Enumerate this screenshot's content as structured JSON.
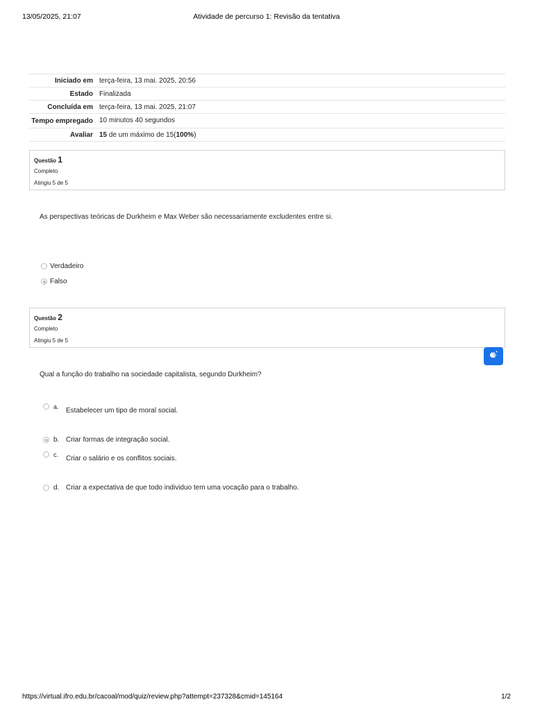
{
  "print": {
    "datetime": "13/05/2025, 21:07",
    "title": "Atividade de percurso 1: Revisão da tentativa",
    "url": "https://virtual.ifro.edu.br/cacoal/mod/quiz/review.php?attempt=237328&cmid=145164",
    "page": "1/2"
  },
  "summary": [
    {
      "label": "Iniciado em",
      "value": "terça-feira, 13 mai. 2025, 20:56"
    },
    {
      "label": "Estado",
      "value": "Finalizada"
    },
    {
      "label": "Concluída em",
      "value": "terça-feira, 13 mai. 2025, 21:07"
    },
    {
      "label": "Tempo empregado",
      "value": "10 minutos 40 segundos"
    },
    {
      "label": "Avaliar",
      "value_bold": "15",
      "value_mid": " de um máximo de 15(",
      "value_bold2": "100%",
      "value_end": ")"
    }
  ],
  "q1": {
    "prefix": "Questão",
    "number": "1",
    "state": "Completo",
    "grade": "Atingiu 5 de 5",
    "text": "As perspectivas teóricas de Durkheim e Max Weber são necessariamente excludentes entre si.",
    "options": [
      {
        "label": "Verdadeiro",
        "selected": false
      },
      {
        "label": "Falso",
        "selected": true
      }
    ]
  },
  "q2": {
    "prefix": "Questão",
    "number": "2",
    "state": "Completo",
    "grade": "Atingiu 5 de 5",
    "text": "Qual a função do trabalho na sociedade capitalista, segundo Durkheim?",
    "options": [
      {
        "letter": "a.",
        "label": "Estabelecer um tipo de moral social.",
        "selected": false
      },
      {
        "letter": "b.",
        "label": "Criar formas de integração social.",
        "selected": true
      },
      {
        "letter": "c.",
        "label": "Criar o salário e os conflitos sociais.",
        "selected": false
      },
      {
        "letter": "d.",
        "label": "Criar a expectativa de que todo individuo tem uma vocação para o trabalho.",
        "selected": false
      }
    ]
  },
  "accessibility_button": {
    "icon": "sign-language-hand-icon",
    "color": "#1a73e8"
  }
}
